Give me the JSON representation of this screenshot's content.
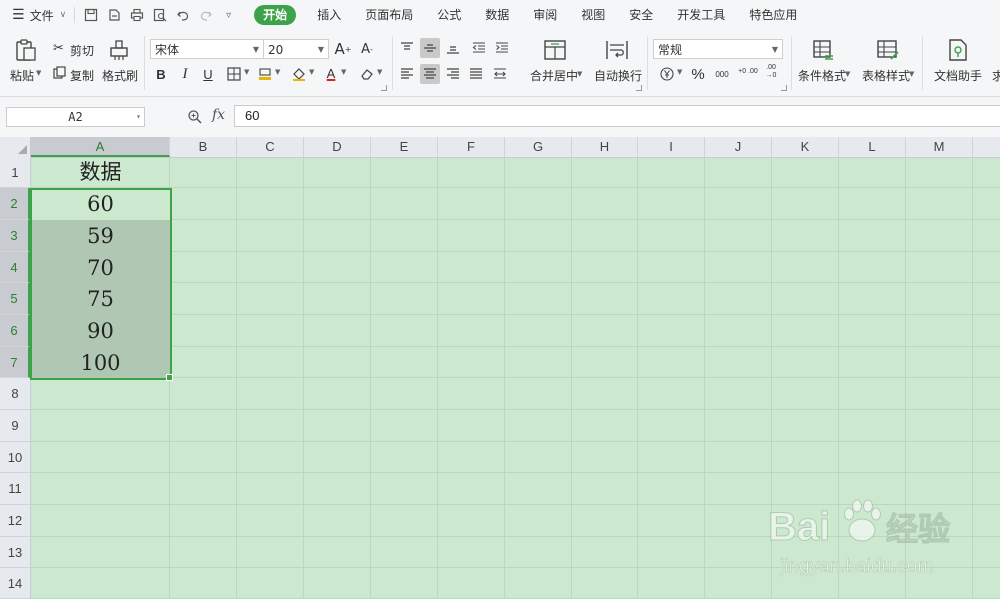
{
  "menubar": {
    "file_label": "文件",
    "tabs": [
      {
        "label": "开始",
        "active": true
      },
      {
        "label": "插入"
      },
      {
        "label": "页面布局"
      },
      {
        "label": "公式"
      },
      {
        "label": "数据"
      },
      {
        "label": "审阅"
      },
      {
        "label": "视图"
      },
      {
        "label": "安全"
      },
      {
        "label": "开发工具"
      },
      {
        "label": "特色应用"
      }
    ]
  },
  "ribbon": {
    "paste": "粘贴",
    "cut": "剪切",
    "copy": "复制",
    "format_painter": "格式刷",
    "font_name": "宋体",
    "font_size": "20",
    "bold": "B",
    "italic": "I",
    "underline": "U",
    "font_color_letter": "A",
    "merge_center": "合并居中",
    "wrap_text": "自动换行",
    "number_format": "常规",
    "percent": "%",
    "thousands": "000",
    "inc_decimal": "+0 .00",
    "dec_decimal": ".00 →0",
    "conditional_format": "条件格式",
    "table_style": "表格样式",
    "doc_assistant": "文档助手",
    "overflow_label": "求"
  },
  "formula_bar": {
    "name_box": "A2",
    "fx_label": "fx",
    "formula_value": "60"
  },
  "sheet": {
    "columns": [
      "A",
      "B",
      "C",
      "D",
      "E",
      "F",
      "G",
      "H",
      "I",
      "J",
      "K",
      "L",
      "M"
    ],
    "rows": [
      "1",
      "2",
      "3",
      "4",
      "5",
      "6",
      "7",
      "8",
      "9",
      "10",
      "11",
      "12",
      "13",
      "14"
    ],
    "cells": {
      "A1": "数据",
      "A2": "60",
      "A3": "59",
      "A4": "70",
      "A5": "75",
      "A6": "90",
      "A7": "100"
    },
    "selection": "A2:A7",
    "active_cell": "A2"
  },
  "watermark": {
    "brand": "Bai",
    "brand_tail": "经验",
    "url": "jingyan.baidu.com"
  },
  "colors": {
    "accent": "#3da34a",
    "sheet_bg": "#cce8cf",
    "selection_fill": "#b0c8b3"
  }
}
